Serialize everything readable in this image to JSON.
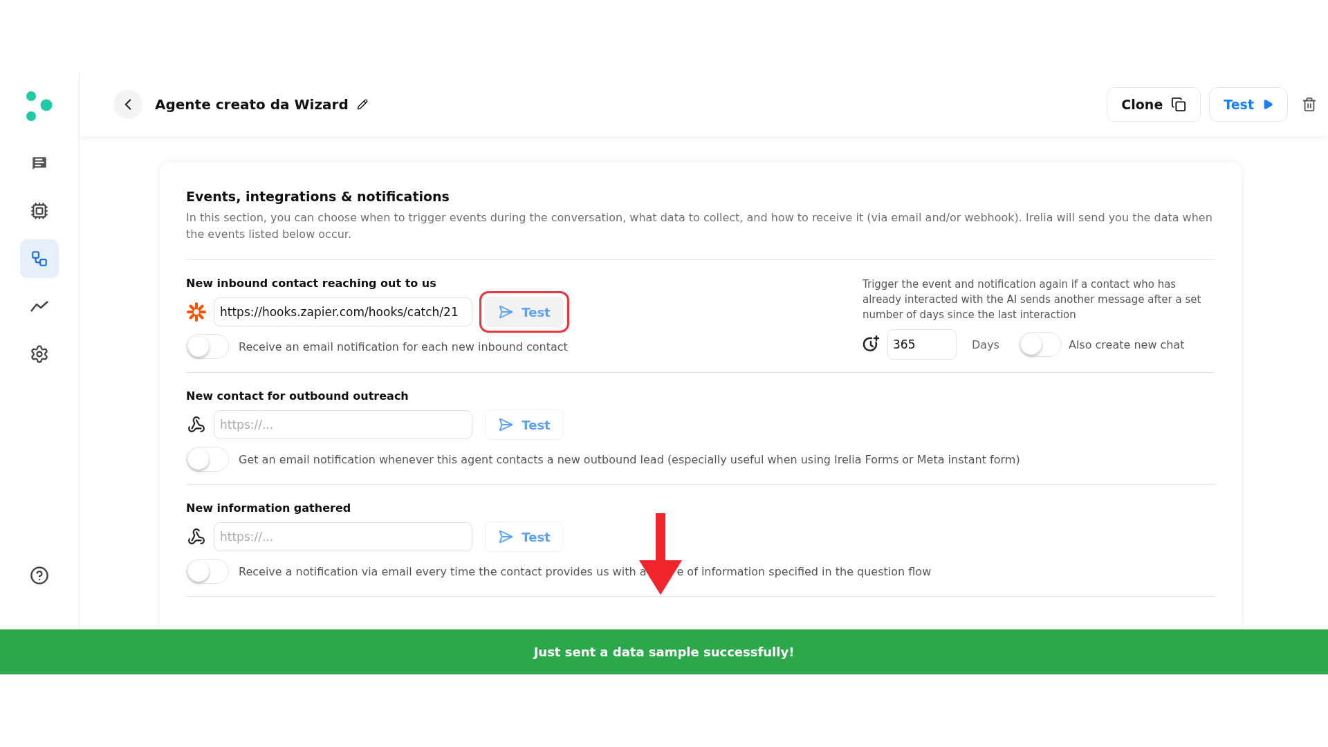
{
  "sidebar": {
    "items": [
      {
        "kind": "chat",
        "selected": false
      },
      {
        "kind": "chip",
        "selected": false
      },
      {
        "kind": "flow",
        "selected": true
      },
      {
        "kind": "chart",
        "selected": false
      },
      {
        "kind": "settings",
        "selected": false
      }
    ],
    "help": {
      "kind": "help"
    }
  },
  "header": {
    "title": "Agente creato da Wizard",
    "buttons": [
      {
        "label": "Clone",
        "kind": "clone"
      },
      {
        "label": "Test",
        "kind": "test"
      }
    ]
  },
  "card": {
    "title": "Events, integrations & notifications",
    "description": "In this section, you can choose when to trigger events during the conversation, what data to collect, and how to receive it (via email and/or webhook). Irelia will send you the data when the events listed below occur.",
    "events": [
      {
        "title": "New inbound contact reaching out to us",
        "kind": "zapier",
        "value": "https://hooks.zapier.com/hooks/catch/21",
        "test_label": "Test",
        "highlighted": true,
        "notification": {
          "parts": [
            {
              "kind": "text",
              "text": "Receive an email notification for each new inbound contact"
            }
          ],
          "on": false
        },
        "retrigger": {
          "description": "Trigger the event and notification again if a contact who has already interacted with the AI sends another message after a set number of days since the last interaction",
          "days_value": "365",
          "days_label": "Days",
          "new_chat": {
            "label": "Also create new chat",
            "on": false
          }
        }
      },
      {
        "title": "New contact for outbound outreach",
        "kind": "webhook",
        "placeholder": "https://...",
        "test_label": "Test",
        "highlighted": false,
        "notification": {
          "parts": [
            {
              "kind": "text",
              "text": "Get an email notification whenever this agent contacts a new outbound lead (especially useful when using Irelia Forms or Meta instant form)"
            }
          ],
          "on": false
        }
      },
      {
        "title": "New information gathered",
        "kind": "webhook",
        "placeholder": "https://...",
        "test_label": "Test",
        "highlighted": false,
        "notification": {
          "parts": [
            {
              "kind": "text",
              "text": "Receive a notification via email every time the contact provides us with a"
            },
            {
              "kind": "arrow"
            },
            {
              "kind": "text",
              "text": "e of information specified in the question flow"
            }
          ],
          "on": false
        }
      }
    ]
  },
  "toast": {
    "message": "Just sent a data sample successfully!"
  }
}
